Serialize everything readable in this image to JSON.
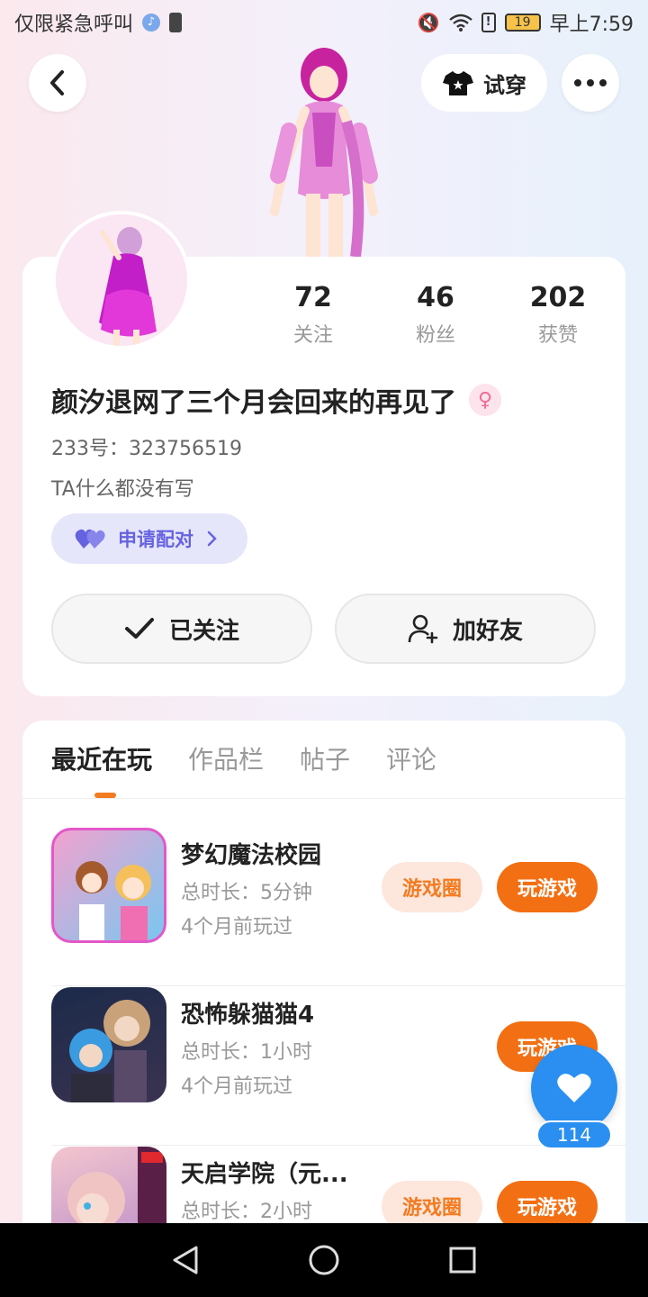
{
  "status_bar": {
    "left_text": "仅限紧急呼叫",
    "battery": "19",
    "time": "早上7:59"
  },
  "header": {
    "tryon_label": "试穿"
  },
  "profile": {
    "stats": [
      {
        "value": "72",
        "label": "关注"
      },
      {
        "value": "46",
        "label": "粉丝"
      },
      {
        "value": "202",
        "label": "获赞"
      }
    ],
    "nickname": "颜汐退网了三个月会回来的再见了",
    "gender_symbol": "♀",
    "uid": "233号：323756519",
    "bio": "TA什么都没有写",
    "pair_label": "申请配对",
    "follow_label": "已关注",
    "add_friend_label": "加好友"
  },
  "tabs": [
    {
      "label": "最近在玩",
      "active": true
    },
    {
      "label": "作品栏",
      "active": false
    },
    {
      "label": "帖子",
      "active": false
    },
    {
      "label": "评论",
      "active": false
    }
  ],
  "games": [
    {
      "name": "梦幻魔法校园",
      "duration": "总时长：5分钟",
      "last_played": "4个月前玩过",
      "circle_label": "游戏圈",
      "play_label": "玩游戏"
    },
    {
      "name": "恐怖躲猫猫4",
      "duration": "总时长：1小时",
      "last_played": "4个月前玩过",
      "circle_label": "",
      "play_label": "玩游戏"
    },
    {
      "name": "天启学院（元...",
      "duration": "总时长：2小时",
      "last_played": "",
      "circle_label": "游戏圈",
      "play_label": "玩游戏"
    }
  ],
  "like": {
    "count": "114"
  },
  "colors": {
    "accent": "#f36f13",
    "pair": "#6663e0",
    "like_fab": "#2a8ff0"
  }
}
